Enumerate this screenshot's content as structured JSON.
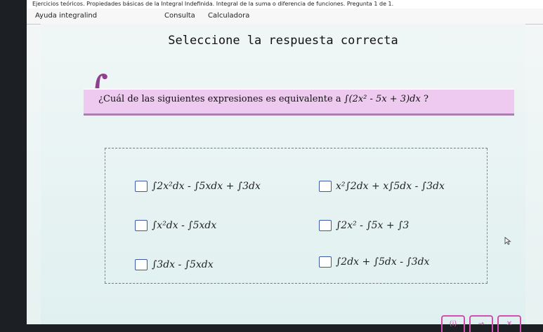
{
  "window": {
    "title": "Ejercicios teóricos. Propiedades básicas de la Integral Indefinida. Integral de la suma o diferencia de funciones. Pregunta 1 de 1."
  },
  "menu": {
    "items": [
      {
        "label": "Ayuda integralind"
      },
      {
        "label": "Consulta"
      },
      {
        "label": "Calculadora"
      }
    ]
  },
  "quiz": {
    "heading": "Seleccione la respuesta correcta",
    "question_prefix": "¿Cuál de las siguientes expresiones es equivalente a ",
    "question_expression": "∫(2x² - 5x + 3)dx",
    "question_suffix": " ?",
    "options": [
      {
        "text": "∫2x²dx - ∫5xdx + ∫3dx"
      },
      {
        "text": "x²∫2dx + x∫5dx - ∫3dx"
      },
      {
        "text": "∫x²dx - ∫5xdx"
      },
      {
        "text": "∫2x² - ∫5x + ∫3"
      },
      {
        "text": "∫3dx - ∫5xdx"
      },
      {
        "text": "∫2dx + ∫5dx - ∫3dx"
      }
    ]
  },
  "decor": {
    "big_integral_glyph": "∫",
    "accent_color": "#d24faf"
  },
  "nav": {
    "buttons": [
      {
        "icon": "info-icon",
        "label": "(i)"
      },
      {
        "icon": "next-arrow-icon",
        "label": "→"
      },
      {
        "icon": "close-icon",
        "label": "✕"
      }
    ]
  }
}
